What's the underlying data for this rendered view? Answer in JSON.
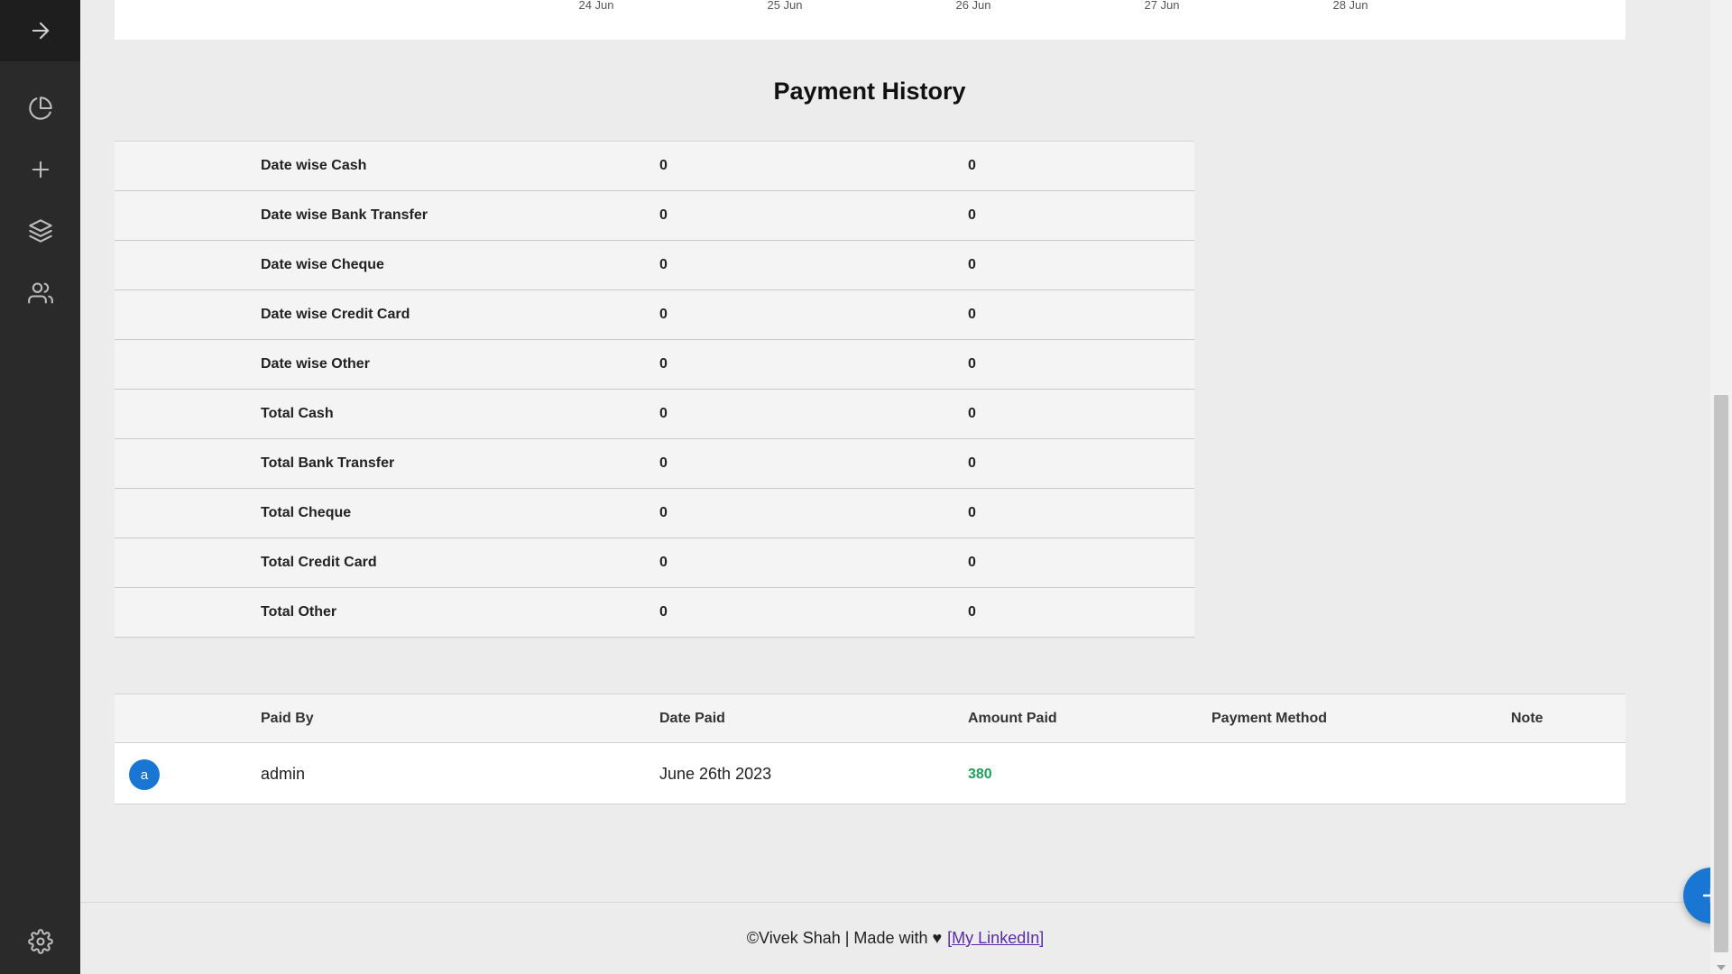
{
  "chart": {
    "x_ticks": [
      "24 Jun",
      "25 Jun",
      "26 Jun",
      "27 Jun",
      "28 Jun"
    ]
  },
  "sidebar": {
    "items": [
      {
        "icon": "arrow-right-icon"
      },
      {
        "icon": "pie-chart-icon"
      },
      {
        "icon": "plus-icon"
      },
      {
        "icon": "layers-icon"
      },
      {
        "icon": "users-icon"
      },
      {
        "icon": "gear-icon"
      }
    ]
  },
  "page_title": "Payment History",
  "summary": {
    "rows": [
      {
        "label": "Date wise Cash",
        "v1": "0",
        "v2": "0"
      },
      {
        "label": "Date wise Bank Transfer",
        "v1": "0",
        "v2": "0"
      },
      {
        "label": "Date wise Cheque",
        "v1": "0",
        "v2": "0"
      },
      {
        "label": "Date wise Credit Card",
        "v1": "0",
        "v2": "0"
      },
      {
        "label": "Date wise Other",
        "v1": "0",
        "v2": "0"
      },
      {
        "label": "Total Cash",
        "v1": "0",
        "v2": "0"
      },
      {
        "label": "Total Bank Transfer",
        "v1": "0",
        "v2": "0"
      },
      {
        "label": "Total Cheque",
        "v1": "0",
        "v2": "0"
      },
      {
        "label": "Total Credit Card",
        "v1": "0",
        "v2": "0"
      },
      {
        "label": "Total Other",
        "v1": "0",
        "v2": "0"
      }
    ]
  },
  "payments": {
    "headers": {
      "paid_by": "Paid By",
      "date_paid": "Date Paid",
      "amount_paid": "Amount Paid",
      "payment_method": "Payment Method",
      "note": "Note"
    },
    "rows": [
      {
        "avatar": "a",
        "paid_by": "admin",
        "date_paid": "June 26th 2023",
        "amount_paid": "380",
        "payment_method": "",
        "note": ""
      }
    ]
  },
  "footer": {
    "text": "©Vivek Shah | Made with ♥",
    "link": "[My LinkedIn]"
  },
  "colors": {
    "accent": "#1976d2",
    "amount": "#1e9e5a",
    "sidebar": "#2a2a2a"
  }
}
